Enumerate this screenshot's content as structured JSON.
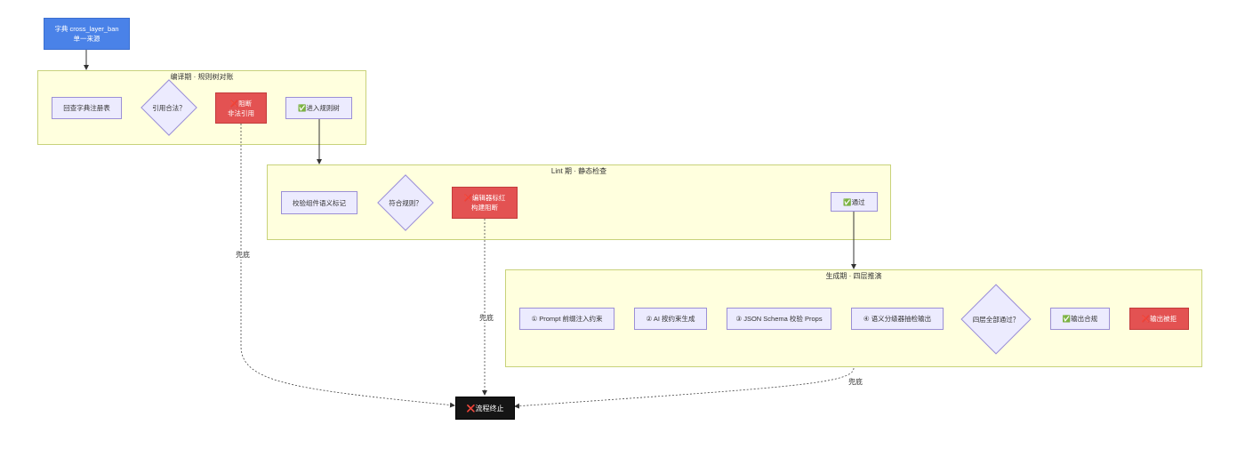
{
  "colors": {
    "subgraph_fill": "#ffffde",
    "subgraph_border": "#c8d27a",
    "node_fill": "#ecebfe",
    "node_border": "#9b8fd6",
    "danger": "#e35252",
    "source": "#4a82e8",
    "terminal": "#151515"
  },
  "source_node": {
    "line1": "字典 cross_layer_ban",
    "line2": "单一来源"
  },
  "compile_phase": {
    "title": "编译期 · 规则树对账",
    "lookup": "回查字典注册表",
    "decision": "引用合法？",
    "block": {
      "icon": "cross-mark-icon",
      "line1": "阻断",
      "line2": "非法引用"
    },
    "enter": {
      "icon": "check-mark-icon",
      "label": "进入规则树"
    }
  },
  "lint_phase": {
    "title": "Lint 期 · 静态检查",
    "check": "校验组件语义标记",
    "decision": "符合规则？",
    "block": {
      "icon": "cross-mark-icon",
      "line1": "编辑器标红",
      "line2": "构建阻断"
    },
    "pass": {
      "icon": "check-mark-icon",
      "label": "通过"
    }
  },
  "gen_phase": {
    "title": "生成期 · 四层推演",
    "step1": "① Prompt 前缀注入约束",
    "step2": "② AI 按约束生成",
    "step3": "③ JSON Schema 校验 Props",
    "step4": "④ 语义分级器抽检输出",
    "decision": "四层全部通过？",
    "pass": {
      "icon": "check-mark-icon",
      "label": "输出合规"
    },
    "block": {
      "icon": "cross-mark-icon",
      "label": "输出被拒"
    }
  },
  "terminal": {
    "icon": "cross-mark-icon",
    "label": "流程终止"
  },
  "edge_labels": {
    "fallback1": "兜底",
    "fallback2": "兜底",
    "fallback3": "兜底"
  },
  "glyphs": {
    "check": "✅",
    "cross": "❌"
  }
}
